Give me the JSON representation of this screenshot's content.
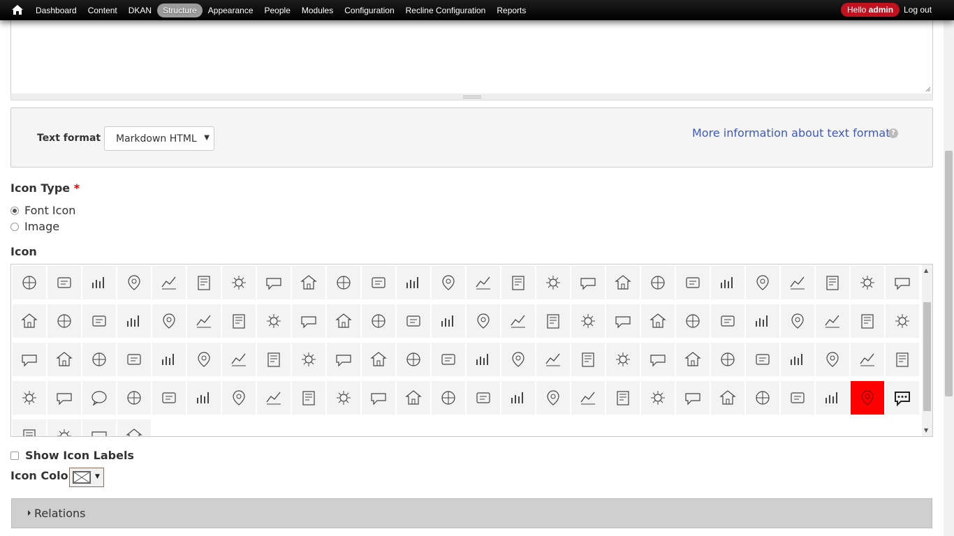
{
  "toolbar": {
    "menu": [
      "Dashboard",
      "Content",
      "DKAN",
      "Structure",
      "Appearance",
      "People",
      "Modules",
      "Configuration",
      "Recline Configuration",
      "Reports"
    ],
    "active": "Structure",
    "hello_prefix": "Hello ",
    "hello_user": "admin",
    "logout": "Log out"
  },
  "text_format": {
    "label": "Text format",
    "selected": "Markdown HTML",
    "more_info": "More information about text formats",
    "help_icon": "question-circle-icon"
  },
  "icon_type": {
    "label": "Icon Type",
    "required_mark": "*",
    "options": [
      "Font Icon",
      "Image"
    ],
    "selected": "Font Icon"
  },
  "icon_field": {
    "label": "Icon",
    "selected_row": 3,
    "selected_col": 24,
    "selected_color": "#ff0000",
    "rows": [
      [
        "cloud-sun-rain-icon",
        "umbrella-icon",
        "briefcase-dollar-icon",
        "bar-chart-icon",
        "bar-chart-circles-icon",
        "bar-chart-growth-icon",
        "line-chart-icon",
        "pie-chart-icon",
        "money-stack-icon",
        "hand-coin-icon",
        "piggy-bank-icon",
        "wallet-icon",
        "globe-icon",
        "map-pin-icon",
        "map-pin-plus-icon",
        "map-icon",
        "map-pin-flag-icon",
        "bank-building-icon",
        "office-building-icon",
        "city-buildings-icon",
        "house-icon",
        "houses-icon",
        "fountain-icon",
        "airplane-icon",
        "cactus-icon",
        "globe-hand-icon"
      ],
      [
        "tree-icon",
        "hexagons-icon",
        "seedling-icon",
        "recycle-icon",
        "solar-tree-icon",
        "water-drop-icon",
        "faucet-icon",
        "pinwheel-icon",
        "basketball-icon",
        "dumbbell-icon",
        "weightlifting-icon",
        "bus-icon",
        "taxi-icon",
        "battery-icon",
        "speedometer-icon",
        "traffic-light-icon",
        "tram-icon",
        "rocket-icon",
        "clipboard-cross-icon",
        "office-chair-icon",
        "toolbox-icon",
        "tools-icon",
        "traffic-cone-icon",
        "shield-bolt-icon",
        "spool-icon",
        "paper-roll-icon"
      ],
      [
        "ambulance-icon",
        "tooth-icon",
        "heart-pulse-icon",
        "hospital-icon",
        "first-aid-kit-icon",
        "monitor-pulse-icon",
        "drink-cup-icon",
        "milk-jug-icon",
        "apple-icon",
        "burger-icon",
        "balloon-icon",
        "gamepad-icon",
        "hand-care-icon",
        "rocking-horse-icon",
        "documents-icon",
        "document-download-icon",
        "document-share-icon",
        "document-stamp-icon",
        "postage-stamp-icon",
        "money-wallet-icon",
        "head-barcode-icon",
        "head-heart-icon",
        "user-profile-icon",
        "team-meeting-icon",
        "family-icon",
        "teacher-icon"
      ],
      [
        "global-people-icon",
        "community-icon",
        "speech-bubble-icon",
        "chat-bubble-icon",
        "thinking-person-icon",
        "gears-icon",
        "gears-alt-icon",
        "cog-icon",
        "cog-outline-icon",
        "gauge-icon",
        "sliders-panel-icon",
        "equalizer-icon",
        "stopwatch-icon",
        "rocket-launch-icon",
        "lightning-icon",
        "typewriter-icon",
        "bus-front-icon",
        "police-hat-icon",
        "apartment-icon",
        "stethoscope-icon",
        "apple-scale-icon",
        "wallet-card-icon",
        "presentation-chart-icon",
        "cube-icon",
        "circuit-chip-icon",
        "chat-dots-icon"
      ],
      [
        "link-icon",
        "document-blank-icon",
        "bar-chart-down-icon",
        "document-text-icon"
      ]
    ]
  },
  "show_labels": {
    "label": "Show Icon Labels",
    "checked": false
  },
  "icon_color": {
    "label": "Icon Color"
  },
  "relations": {
    "label": "Relations"
  }
}
